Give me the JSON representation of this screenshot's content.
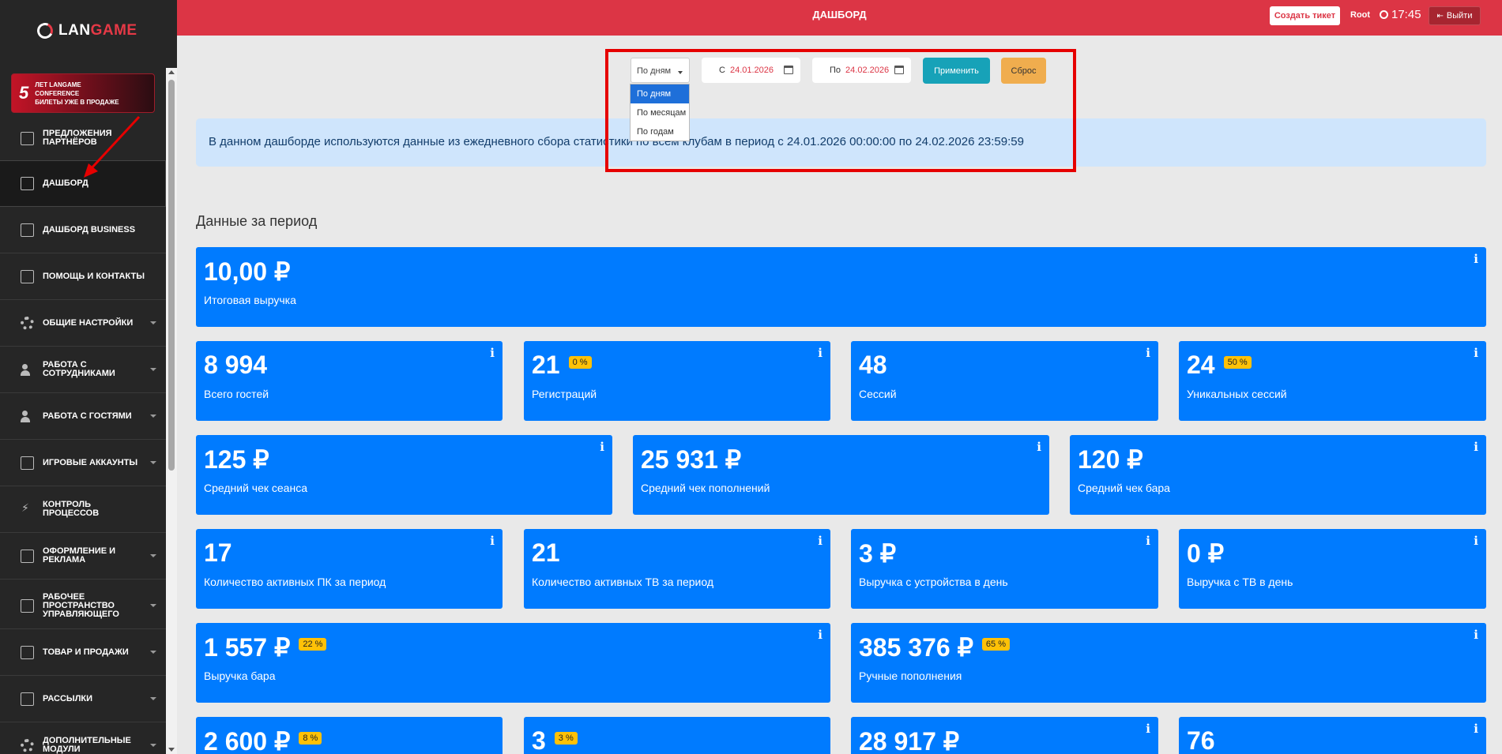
{
  "sidebar": {
    "logo": {
      "part1": "LAN",
      "part2": "GAME"
    },
    "promo": {
      "number": "5",
      "line1": "ЛЕТ LANGAME",
      "line2": "CONFERENCE",
      "line3": "БИЛЕТЫ УЖЕ В ПРОДАЖЕ"
    },
    "items": [
      {
        "label": "ПРЕДЛОЖЕНИЯ ПАРТНЁРОВ",
        "icon": "edit-icon"
      },
      {
        "label": "ДАШБОРД",
        "icon": "notebook-icon",
        "active": true
      },
      {
        "label": "ДАШБОРД BUSINESS",
        "icon": "edit-icon"
      },
      {
        "label": "ПОМОЩЬ И КОНТАКТЫ",
        "icon": "edit-icon"
      },
      {
        "label": "ОБЩИЕ НАСТРОЙКИ",
        "icon": "gear-icon"
      },
      {
        "label": "РАБОТА С СОТРУДНИКАМИ",
        "icon": "people-icon"
      },
      {
        "label": "РАБОТА С ГОСТЯМИ",
        "icon": "people-icon"
      },
      {
        "label": "ИГРОВЫЕ АККАУНТЫ",
        "icon": "account-icon"
      },
      {
        "label": "КОНТРОЛЬ ПРОЦЕССОВ",
        "icon": "bolt-icon"
      },
      {
        "label": "ОФОРМЛЕНИЕ И РЕКЛАМА",
        "icon": "edit-icon"
      },
      {
        "label": "РАБОЧЕЕ ПРОСТРАНСТВО УПРАВЛЯЮЩЕГО",
        "icon": "briefcase-icon"
      },
      {
        "label": "ТОВАР И ПРОДАЖИ",
        "icon": "note-icon"
      },
      {
        "label": "РАССЫЛКИ",
        "icon": "edit-icon"
      },
      {
        "label": "ДОПОЛНИТЕЛЬНЫЕ МОДУЛИ",
        "icon": "gear-icon"
      }
    ]
  },
  "header": {
    "title": "ДАШБОРД",
    "ticket_button": "Создать тикет",
    "user": "Root",
    "time": "17:45",
    "logout_button": "Выйти"
  },
  "filter": {
    "period_selected": "По дням",
    "period_options": [
      "По дням",
      "По месяцам",
      "По годам"
    ],
    "from_label": "С",
    "from_value": "24.01.2026",
    "to_label": "По",
    "to_value": "24.02.2026",
    "apply_button": "Применить",
    "reset_button": "Сброс"
  },
  "info_text": "В данном дашборде используются данные из ежедневного сбора статистики по всем клубам в период с 24.01.2026 00:00:00 по 24.02.2026 23:59:59",
  "section_title": "Данные за период",
  "cards": {
    "total_revenue": {
      "value": "10,00 ₽",
      "label": "Итоговая выручка"
    },
    "guests": {
      "value": "8 994",
      "label": "Всего гостей"
    },
    "registrations": {
      "value": "21",
      "badge": "0 %",
      "label": "Регистраций"
    },
    "sessions": {
      "value": "48",
      "label": "Сессий"
    },
    "unique_sessions": {
      "value": "24",
      "badge": "50 %",
      "label": "Уникальных сессий"
    },
    "avg_session": {
      "value": "125 ₽",
      "label": "Средний чек сеанса"
    },
    "avg_topup": {
      "value": "25 931 ₽",
      "label": "Средний чек пополнений"
    },
    "avg_bar": {
      "value": "120 ₽",
      "label": "Средний чек бара"
    },
    "active_pc": {
      "value": "17",
      "label": "Количество активных ПК за период"
    },
    "active_tv": {
      "value": "21",
      "label": "Количество активных ТВ за период"
    },
    "device_revenue": {
      "value": "3 ₽",
      "label": "Выручка с устройства в день"
    },
    "tv_revenue": {
      "value": "0 ₽",
      "label": "Выручка с ТВ в день"
    },
    "bar_revenue": {
      "value": "1 557 ₽",
      "badge": "22 %",
      "label": "Выручка бара"
    },
    "manual_topups": {
      "value": "385 376 ₽",
      "badge": "65 %",
      "label": "Ручные пополнения"
    },
    "row6_a": {
      "value": "2 600 ₽",
      "badge": "8 %"
    },
    "row6_b": {
      "value": "3",
      "badge": "3 %"
    },
    "row6_c": {
      "value": "28 917 ₽"
    },
    "row6_d": {
      "value": "76"
    }
  }
}
